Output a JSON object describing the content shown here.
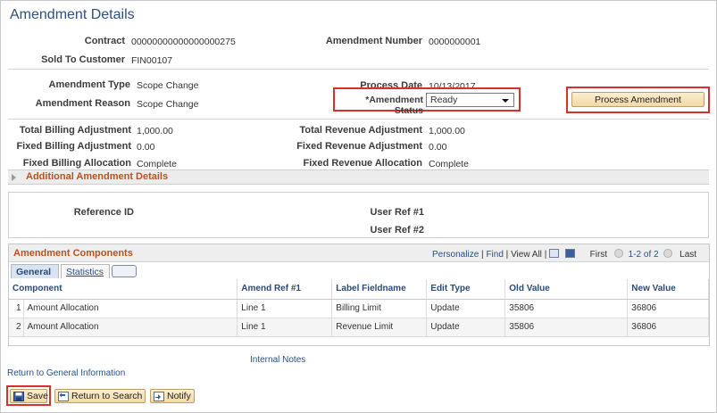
{
  "page": {
    "title": "Amendment Details"
  },
  "header": {
    "contract_label": "Contract",
    "contract_value": "00000000000000000275",
    "amendment_number_label": "Amendment Number",
    "amendment_number_value": "0000000001",
    "sold_to_label": "Sold To Customer",
    "sold_to_value": "FIN00107",
    "amendment_type_label": "Amendment Type",
    "amendment_type_value": "Scope Change",
    "process_date_label": "Process Date",
    "process_date_value": "10/13/2017",
    "amendment_reason_label": "Amendment Reason",
    "amendment_reason_value": "Scope Change",
    "amendment_status_label": "*Amendment Status",
    "amendment_status_value": "Ready",
    "process_button": "Process Amendment"
  },
  "adjustments": {
    "total_billing_label": "Total Billing Adjustment",
    "total_billing_value": "1,000.00",
    "total_revenue_label": "Total Revenue Adjustment",
    "total_revenue_value": "1,000.00",
    "fixed_billing_label": "Fixed Billing Adjustment",
    "fixed_billing_value": "0.00",
    "fixed_revenue_label": "Fixed Revenue Adjustment",
    "fixed_revenue_value": "0.00",
    "fixed_billing_alloc_label": "Fixed Billing Allocation",
    "fixed_billing_alloc_value": "Complete",
    "fixed_revenue_alloc_label": "Fixed Revenue Allocation",
    "fixed_revenue_alloc_value": "Complete"
  },
  "additional_section": {
    "title": "Additional Amendment Details"
  },
  "refs": {
    "reference_id_label": "Reference ID",
    "user_ref1_label": "User Ref #1",
    "user_ref2_label": "User Ref #2"
  },
  "components": {
    "title": "Amendment Components",
    "personalize": "Personalize",
    "find": "Find",
    "view_all": "View All",
    "first": "First",
    "range": "1-2 of 2",
    "last": "Last",
    "tabs": [
      "General",
      "Statistics"
    ],
    "columns": [
      "Component",
      "Amend Ref #1",
      "Label Fieldname",
      "Edit Type",
      "Old Value",
      "New Value"
    ],
    "rows": [
      {
        "n": "1",
        "component": "Amount Allocation",
        "ref": "Line 1",
        "label": "Billing Limit",
        "edit": "Update",
        "old": "35806",
        "new": "36806"
      },
      {
        "n": "2",
        "component": "Amount Allocation",
        "ref": "Line 1",
        "label": "Revenue Limit",
        "edit": "Update",
        "old": "35806",
        "new": "36806"
      }
    ]
  },
  "links": {
    "internal_notes": "Internal Notes",
    "return_general": "Return to General Information"
  },
  "toolbar": {
    "save": "Save",
    "return_search": "Return to Search",
    "notify": "Notify"
  },
  "colors": {
    "highlight": "#d9302a",
    "title": "#2f4f7f",
    "section": "#b5531f"
  }
}
